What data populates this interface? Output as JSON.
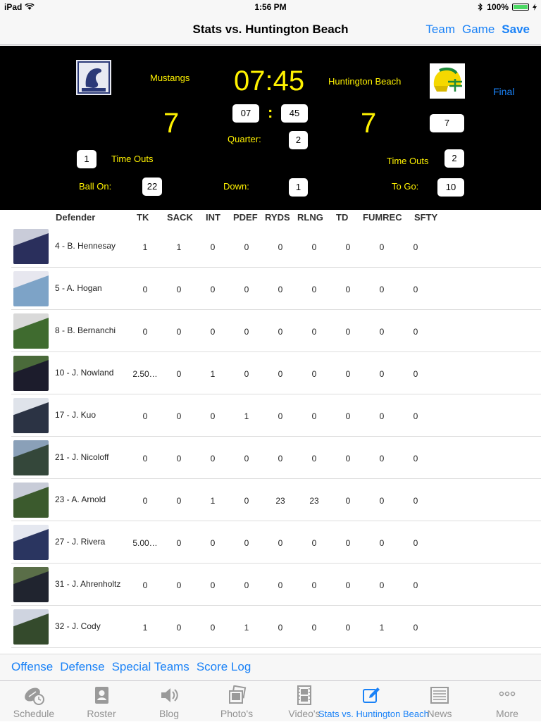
{
  "status": {
    "device": "iPad",
    "time": "1:56 PM",
    "battery": "100%"
  },
  "nav": {
    "title": "Stats vs. Huntington Beach",
    "actions": [
      "Team",
      "Game",
      "Save"
    ]
  },
  "scoreboard": {
    "home": {
      "name": "Mustangs",
      "score": "7",
      "timeouts": "1"
    },
    "away": {
      "name": "Huntington Beach",
      "score": "7",
      "timeouts": "2",
      "box": "7"
    },
    "clock": "07:45",
    "clock_min": "07",
    "clock_sec": "45",
    "clock_sep": ":",
    "quarter_label": "Quarter:",
    "quarter": "2",
    "timeouts_label": "Time Outs",
    "ball_on_label": "Ball On:",
    "ball_on": "22",
    "down_label": "Down:",
    "down": "1",
    "to_go_label": "To Go:",
    "to_go": "10",
    "final_label": "Final"
  },
  "table": {
    "headers": [
      "Defender",
      "TK",
      "SACK",
      "INT",
      "PDEF",
      "RYDS",
      "RLNG",
      "TD",
      "FUMREC",
      "SFTY"
    ],
    "rows": [
      {
        "name": "4 - B. Hennesay",
        "vals": [
          "1",
          "1",
          "0",
          "0",
          "0",
          "0",
          "0",
          "0",
          "0"
        ]
      },
      {
        "name": "5 - A. Hogan",
        "vals": [
          "0",
          "0",
          "0",
          "0",
          "0",
          "0",
          "0",
          "0",
          "0"
        ]
      },
      {
        "name": "8 - B. Bernanchi",
        "vals": [
          "0",
          "0",
          "0",
          "0",
          "0",
          "0",
          "0",
          "0",
          "0"
        ]
      },
      {
        "name": "10 - J. Nowland",
        "vals": [
          "2.50…",
          "0",
          "1",
          "0",
          "0",
          "0",
          "0",
          "0",
          "0"
        ]
      },
      {
        "name": "17 - J. Kuo",
        "vals": [
          "0",
          "0",
          "0",
          "1",
          "0",
          "0",
          "0",
          "0",
          "0"
        ]
      },
      {
        "name": "21 - J. Nicoloff",
        "vals": [
          "0",
          "0",
          "0",
          "0",
          "0",
          "0",
          "0",
          "0",
          "0"
        ]
      },
      {
        "name": "23 - A. Arnold",
        "vals": [
          "0",
          "0",
          "1",
          "0",
          "23",
          "23",
          "0",
          "0",
          "0"
        ]
      },
      {
        "name": "27 - J. Rivera",
        "vals": [
          "5.00…",
          "0",
          "0",
          "0",
          "0",
          "0",
          "0",
          "0",
          "0"
        ]
      },
      {
        "name": "31 - J. Ahrenholtz",
        "vals": [
          "0",
          "0",
          "0",
          "0",
          "0",
          "0",
          "0",
          "0",
          "0"
        ]
      },
      {
        "name": "32 - J. Cody",
        "vals": [
          "1",
          "0",
          "0",
          "1",
          "0",
          "0",
          "0",
          "1",
          "0"
        ]
      }
    ]
  },
  "segments": [
    "Offense",
    "Defense",
    "Special Teams",
    "Score Log"
  ],
  "tabs": [
    {
      "label": "Schedule",
      "icon": "football-clock-icon"
    },
    {
      "label": "Roster",
      "icon": "roster-book-icon"
    },
    {
      "label": "Blog",
      "icon": "speaker-icon"
    },
    {
      "label": "Photo's",
      "icon": "photos-icon"
    },
    {
      "label": "Video's",
      "icon": "film-icon"
    },
    {
      "label": "Stats vs. Huntington Beach",
      "icon": "pencil-edit-icon"
    },
    {
      "label": "News",
      "icon": "newspaper-icon"
    },
    {
      "label": "More",
      "icon": "more-dots-icon"
    }
  ],
  "colors": {
    "accent": "#1a82f7",
    "scoreboard_text": "#fff200",
    "scoreboard_bg": "#000000"
  }
}
